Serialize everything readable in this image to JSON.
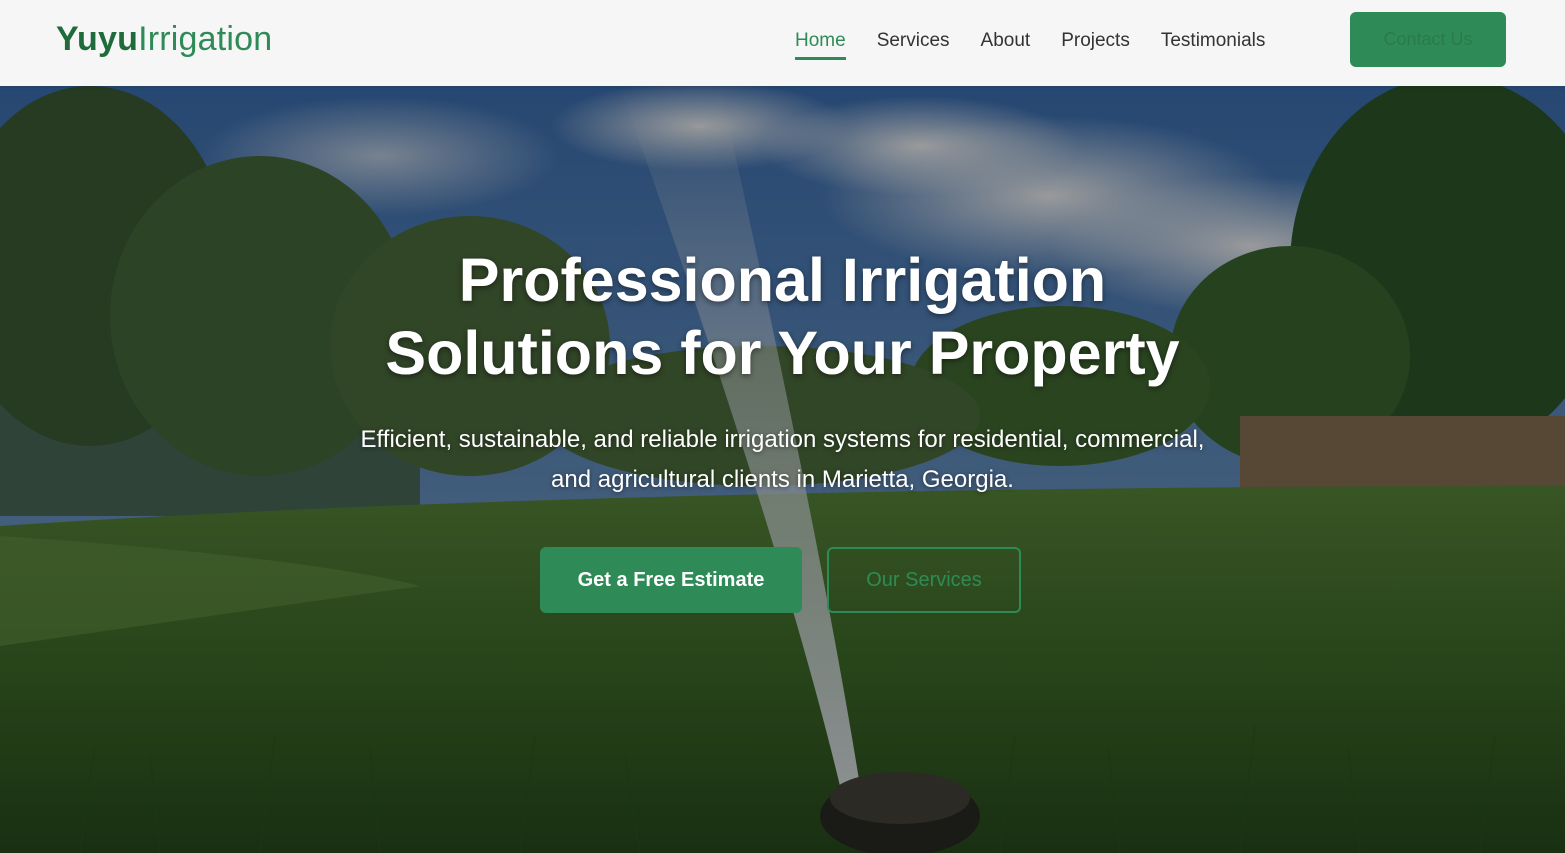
{
  "header": {
    "logo_bold": "Yuyu",
    "logo_light": "Irrigation",
    "nav": [
      {
        "label": "Home",
        "active": true
      },
      {
        "label": "Services",
        "active": false
      },
      {
        "label": "About",
        "active": false
      },
      {
        "label": "Projects",
        "active": false
      },
      {
        "label": "Testimonials",
        "active": false
      }
    ],
    "contact_label": "Contact Us"
  },
  "hero": {
    "title_line1": "Professional Irrigation",
    "title_line2": "Solutions for Your Property",
    "subtitle_line1": "Efficient, sustainable, and reliable irrigation systems for residential, commercial,",
    "subtitle_line2": "and agricultural clients in Marietta, Georgia.",
    "primary_cta": "Get a Free Estimate",
    "secondary_cta": "Our Services"
  },
  "colors": {
    "brand_green": "#2e8b57",
    "brand_dark": "#1f6b3c",
    "header_bg": "#f5f6f5"
  }
}
